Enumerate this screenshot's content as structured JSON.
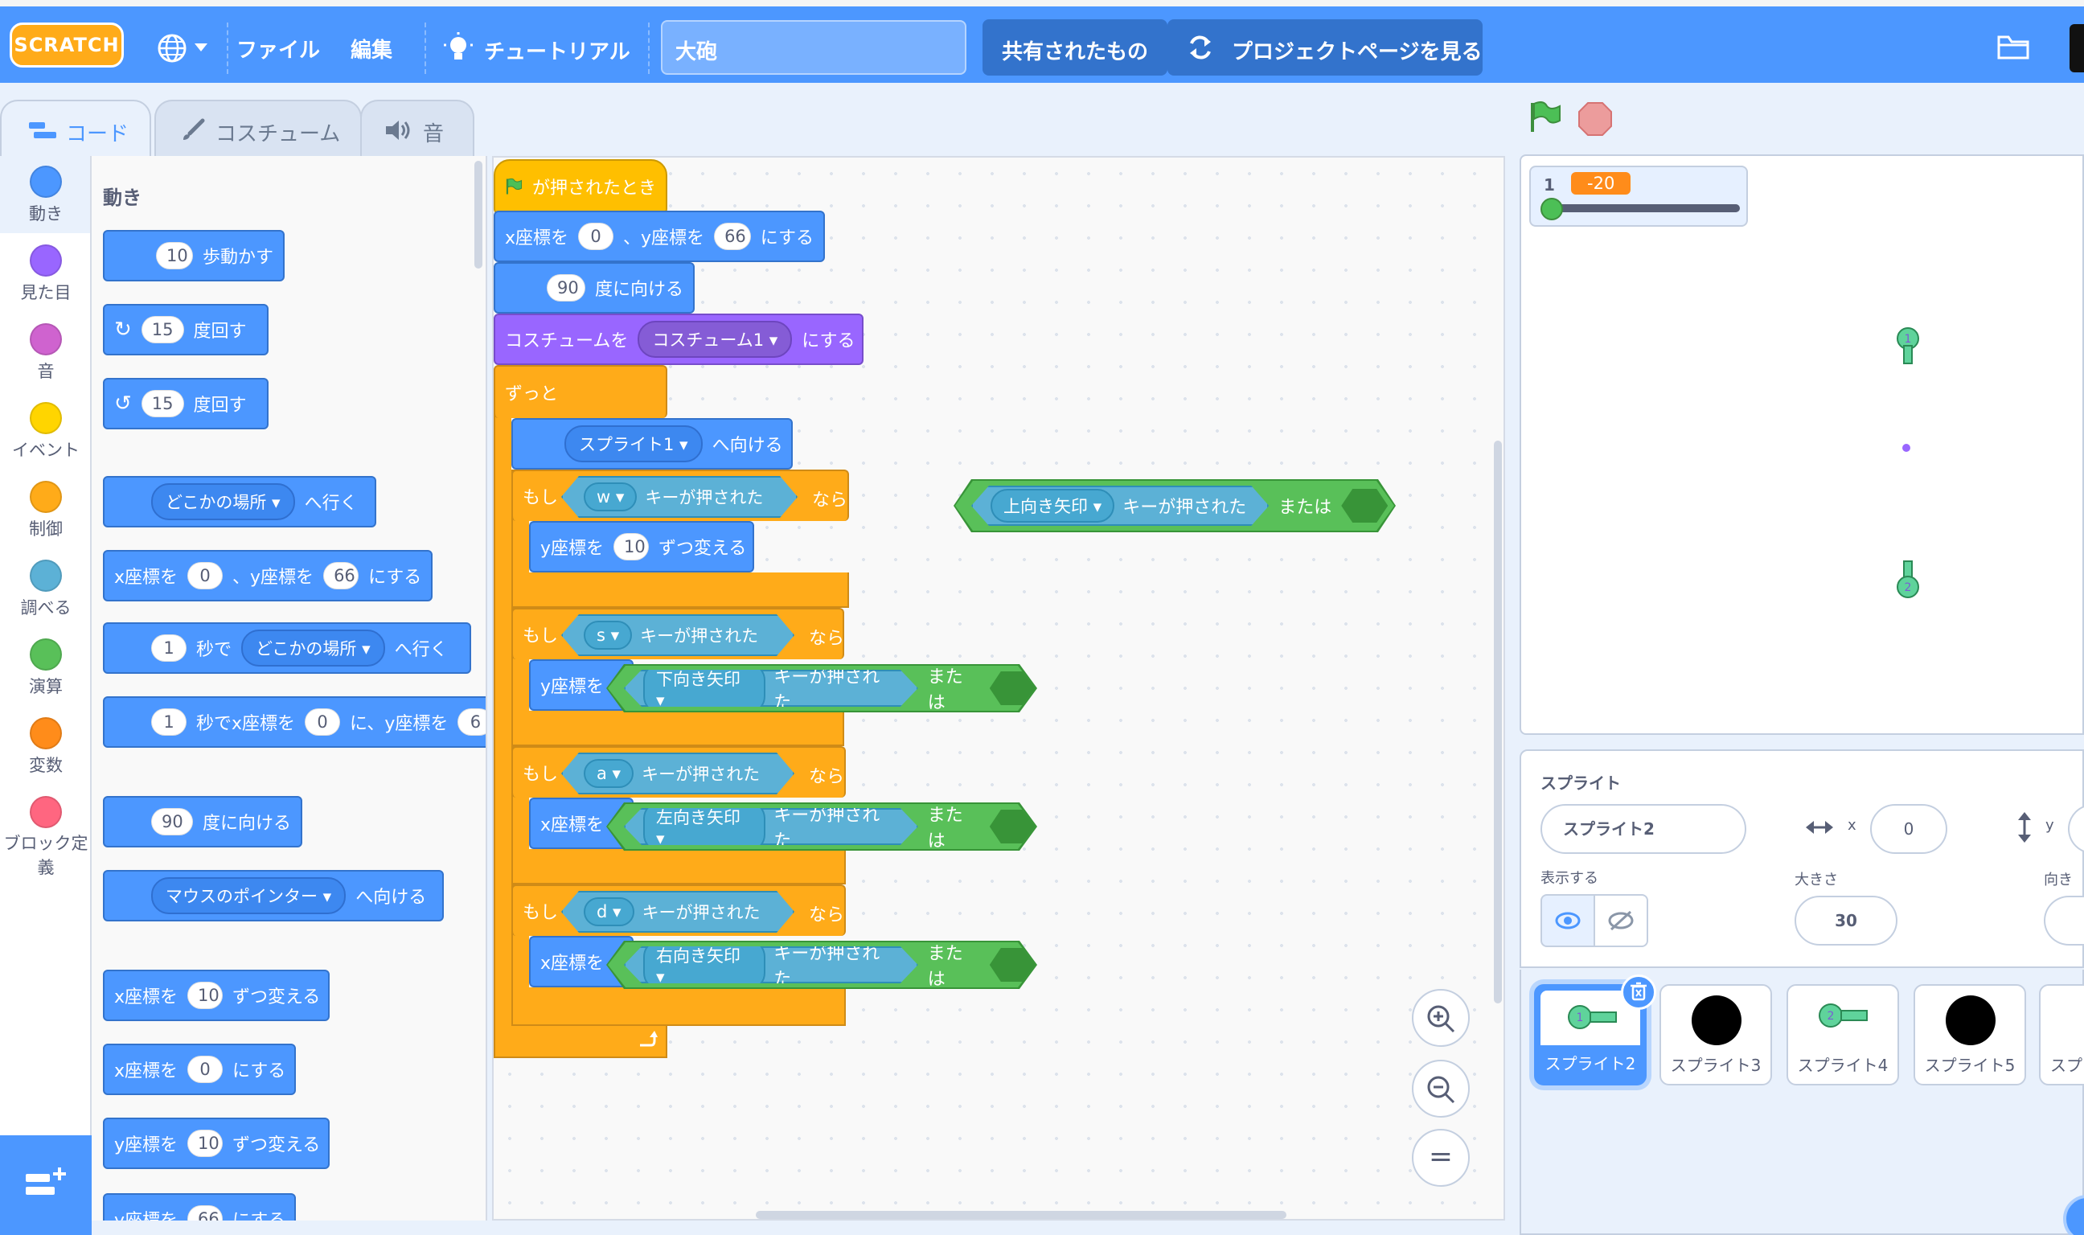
{
  "menu": {
    "logo": "SCRATCH",
    "file": "ファイル",
    "edit": "編集",
    "tutorials": "チュートリアル",
    "project_title": "大砲",
    "shared_button": "共有されたもの",
    "project_page_button": "プロジェクトページを見る"
  },
  "tabs": {
    "code": "コード",
    "costumes": "コスチューム",
    "sounds": "音"
  },
  "categories": [
    {
      "label": "動き",
      "color": "#4c97ff"
    },
    {
      "label": "見た目",
      "color": "#9966ff"
    },
    {
      "label": "音",
      "color": "#cf63cf"
    },
    {
      "label": "イベント",
      "color": "#ffd500"
    },
    {
      "label": "制御",
      "color": "#ffab19"
    },
    {
      "label": "調べる",
      "color": "#5cb1d6"
    },
    {
      "label": "演算",
      "color": "#59c059"
    },
    {
      "label": "変数",
      "color": "#ff8c1a"
    },
    {
      "label": "ブロック定義",
      "color": "#ff6680"
    }
  ],
  "palette": {
    "heading": "動き",
    "move": {
      "value": "10",
      "text": "歩動かす"
    },
    "turn_right": {
      "value": "15",
      "text": "度回す"
    },
    "turn_left": {
      "value": "15",
      "text": "度回す"
    },
    "goto": {
      "dropdown": "どこかの場所",
      "text": "へ行く"
    },
    "goto_xy": {
      "t1": "x座標を",
      "x": "0",
      "t2": "、y座標を",
      "y": "66",
      "t3": "にする"
    },
    "glide": {
      "value": "1",
      "t1": "秒で",
      "dropdown": "どこかの場所",
      "t2": "へ行く"
    },
    "glide_xy": {
      "value": "1",
      "t1": "秒でx座標を",
      "x": "0",
      "t2": "に、y座標を",
      "y": "6"
    },
    "point_dir": {
      "value": "90",
      "text": "度に向ける"
    },
    "point_towards": {
      "dropdown": "マウスのポインター",
      "text": "へ向ける"
    },
    "change_x": {
      "t1": "x座標を",
      "value": "10",
      "t2": "ずつ変える"
    },
    "set_x": {
      "t1": "x座標を",
      "value": "0",
      "t2": "にする"
    },
    "change_y": {
      "t1": "y座標を",
      "value": "10",
      "t2": "ずつ変える"
    },
    "set_y_partial": {
      "t1": "y座標を",
      "value": "66",
      "t2": "にする"
    }
  },
  "script": {
    "hat": "が押されたとき",
    "goto_xy": {
      "t1": "x座標を",
      "x": "0",
      "t2": "、y座標を",
      "y": "66",
      "t3": "にする"
    },
    "point_dir": {
      "value": "90",
      "text": "度に向ける"
    },
    "costume": {
      "t1": "コスチュームを",
      "dropdown": "コスチューム1",
      "t2": "にする"
    },
    "forever": "ずっと",
    "point_towards": {
      "dropdown": "スプライト1",
      "text": "へ向ける"
    },
    "if1": {
      "if": "もし",
      "key": "w",
      "pressed": "キーが押された",
      "then": "なら"
    },
    "change_y": {
      "t1": "y座標を",
      "value": "10",
      "t2": "ずつ変える"
    },
    "if2": {
      "if": "もし",
      "key": "s",
      "pressed": "キーが押された",
      "then": "なら"
    },
    "if2_body": "y座標を",
    "if3": {
      "if": "もし",
      "key": "a",
      "pressed": "キーが押された",
      "then": "なら"
    },
    "if3_body": "x座標を",
    "if4": {
      "if": "もし",
      "key": "d",
      "pressed": "キーが押された",
      "then": "なら"
    },
    "if4_body": "x座標を",
    "or_up": {
      "key": "上向き矢印",
      "pressed": "キーが押された",
      "or": "または"
    },
    "or_down": {
      "key": "下向き矢印",
      "pressed": "キーが押された",
      "or": "または"
    },
    "or_left": {
      "key": "左向き矢印",
      "pressed": "キーが押された",
      "or": "または"
    },
    "or_right": {
      "key": "右向き矢印",
      "pressed": "キーが押された",
      "or": "または"
    }
  },
  "zoom": {
    "reset": "="
  },
  "monitor": {
    "name": "1",
    "value": "-20",
    "slider_fraction": 0
  },
  "sprite_info": {
    "heading": "スプライト",
    "name": "スプライト2",
    "x_label": "x",
    "x_value": "0",
    "y_label": "y",
    "show_label": "表示する",
    "size_label": "大きさ",
    "size_value": "30",
    "direction_label": "向き"
  },
  "sprites": [
    {
      "name": "スプライト2",
      "selected": true
    },
    {
      "name": "スプライト3",
      "selected": false
    },
    {
      "name": "スプライト4",
      "selected": false
    },
    {
      "name": "スプライト5",
      "selected": false
    },
    {
      "name": "スプ",
      "selected": false
    }
  ]
}
